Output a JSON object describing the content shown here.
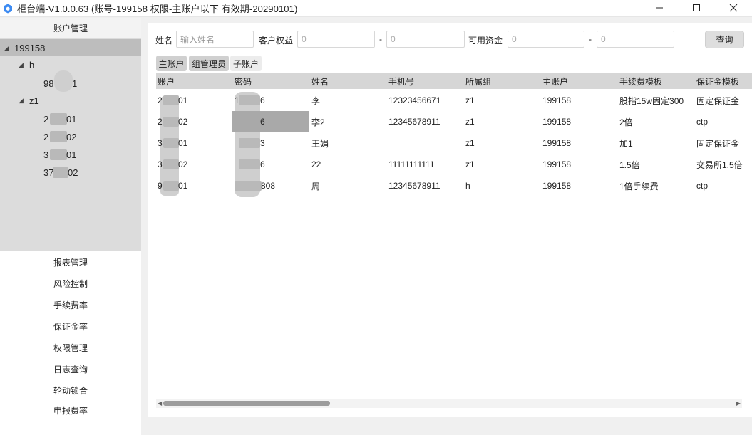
{
  "window": {
    "title": "柜台端-V1.0.0.63 (账号-199158 权限-主账户以下 有效期-20290101)"
  },
  "sidebar": {
    "header": "账户管理",
    "tree": [
      {
        "label": "199158",
        "expanded": true,
        "selected": true
      },
      {
        "label": "h",
        "expanded": true
      },
      {
        "label": "98",
        "suffix": "1"
      },
      {
        "label": "z1",
        "expanded": true
      },
      {
        "label": "2",
        "suffix": "01"
      },
      {
        "label": "2",
        "suffix": "02"
      },
      {
        "label": "3",
        "suffix": "01"
      },
      {
        "label": "37",
        "suffix": "02"
      }
    ],
    "menu": [
      "报表管理",
      "风险控制",
      "手续费率",
      "保证金率",
      "权限管理",
      "日志查询",
      "轮动锁合",
      "申报费率"
    ]
  },
  "filter": {
    "name_label": "姓名",
    "name_placeholder": "输入姓名",
    "equity_label": "客户权益",
    "equity_min": "0",
    "equity_max": "0",
    "dash": "-",
    "funds_label": "可用资金",
    "funds_min": "0",
    "funds_max": "0",
    "query_label": "查询"
  },
  "tabs": [
    "主账户",
    "组管理员",
    "子账户"
  ],
  "table": {
    "columns": [
      "账户",
      "密码",
      "姓名",
      "手机号",
      "所属组",
      "主账户",
      "手续费模板",
      "保证金模板"
    ],
    "rows": [
      {
        "account_a": "2",
        "account_b": "01",
        "pwd_a": "1",
        "pwd_b": "6",
        "name": "李",
        "phone": "12323456671",
        "group": "z1",
        "master": "199158",
        "fee": "股指15w固定300",
        "margin": "固定保证金"
      },
      {
        "account_a": "2",
        "account_b": "02",
        "pwd_a": "",
        "pwd_b": "6",
        "name": "李2",
        "phone": "12345678911",
        "group": "z1",
        "master": "199158",
        "fee": "2倍",
        "margin": "ctp"
      },
      {
        "account_a": "3",
        "account_b": "01",
        "pwd_a": "",
        "pwd_b": "3",
        "name": "王娟",
        "phone": "",
        "group": "z1",
        "master": "199158",
        "fee": "加1",
        "margin": "固定保证金"
      },
      {
        "account_a": "3",
        "account_b": "02",
        "pwd_a": "",
        "pwd_b": "6",
        "name": "22",
        "phone": "11111111111",
        "group": "z1",
        "master": "199158",
        "fee": "1.5倍",
        "margin": "交易所1.5倍"
      },
      {
        "account_a": "9",
        "account_b": "01",
        "pwd_a": "",
        "pwd_b": "808",
        "name": "周",
        "phone": "12345678911",
        "group": "h",
        "master": "199158",
        "fee": "1倍手续费",
        "margin": "ctp"
      }
    ]
  },
  "colors": {
    "accent_icon": "#3d8bf2",
    "tree_bg": "#dcdcdc",
    "tree_selected": "#bdbdbd",
    "header_bg": "#d6d6d6"
  }
}
